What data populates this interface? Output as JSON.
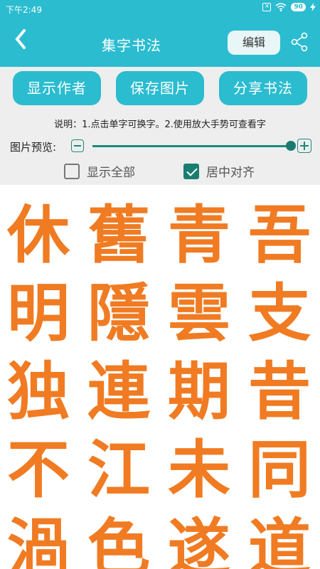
{
  "status": {
    "time": "下午2:49",
    "battery": "90"
  },
  "appbar": {
    "back_icon": "back-chevron-icon",
    "title": "集字书法",
    "edit_label": "编辑",
    "share_icon": "share-icon"
  },
  "buttons": {
    "show_author": "显示作者",
    "save_image": "保存图片",
    "share_calligraphy": "分享书法"
  },
  "note": "说明：1.点击单字可换字。2.使用放大手势可查看字",
  "preview": {
    "label": "图片预览:",
    "slider_value": 0.95
  },
  "options": {
    "show_all": {
      "label": "显示全部",
      "checked": false
    },
    "center_align": {
      "label": "居中对齐",
      "checked": true
    }
  },
  "calligraphy": {
    "color": "#f07b22",
    "rows": [
      [
        "休",
        "舊",
        "青",
        "吾"
      ],
      [
        "明",
        "隱",
        "雲",
        "支"
      ],
      [
        "独",
        "連",
        "期",
        "昔"
      ],
      [
        "不",
        "江",
        "未",
        "同"
      ],
      [
        "渦",
        "色",
        "遂",
        "道"
      ]
    ]
  }
}
